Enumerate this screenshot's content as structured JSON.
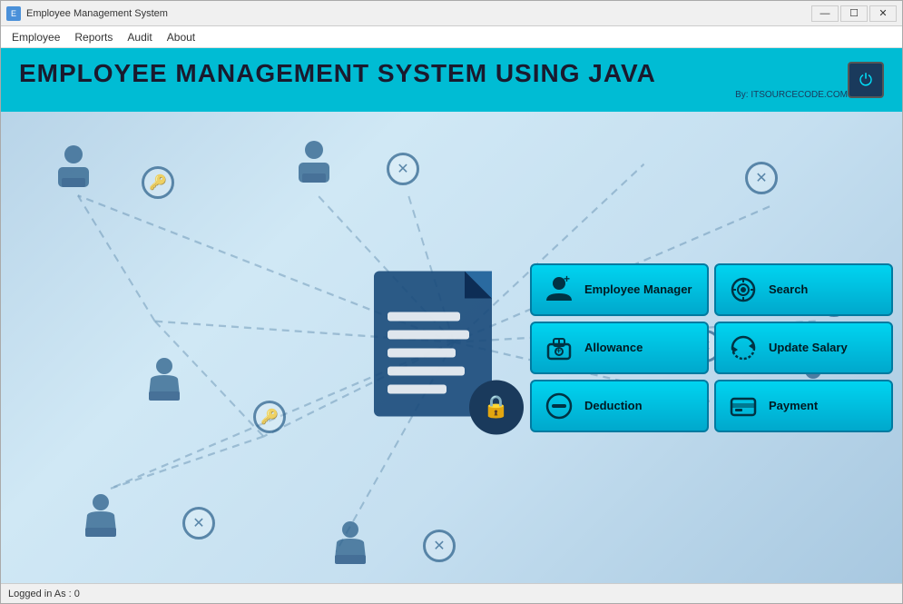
{
  "window": {
    "title": "Employee Management System",
    "icon_label": "E"
  },
  "titlebar": {
    "minimize_label": "—",
    "maximize_label": "☐",
    "close_label": "✕"
  },
  "menu": {
    "items": [
      {
        "label": "Employee"
      },
      {
        "label": "Reports"
      },
      {
        "label": "Audit"
      },
      {
        "label": "About"
      }
    ]
  },
  "header": {
    "title": "EMPLOYEE MANAGEMENT SYSTEM USING JAVA",
    "subtitle": "By: ITSOURCECODE.COM",
    "power_label": "⏻"
  },
  "buttons": [
    {
      "id": "employee-manager",
      "label": "Employee Manager",
      "icon": "person-plus"
    },
    {
      "id": "search",
      "label": "Search",
      "icon": "search-target"
    },
    {
      "id": "allowance",
      "label": "Allowance",
      "icon": "allowance"
    },
    {
      "id": "update-salary",
      "label": "Update Salary",
      "icon": "refresh"
    },
    {
      "id": "deduction",
      "label": "Deduction",
      "icon": "minus-circle"
    },
    {
      "id": "payment",
      "label": "Payment",
      "icon": "card"
    }
  ],
  "status_bar": {
    "text": "Logged in As : 0"
  }
}
